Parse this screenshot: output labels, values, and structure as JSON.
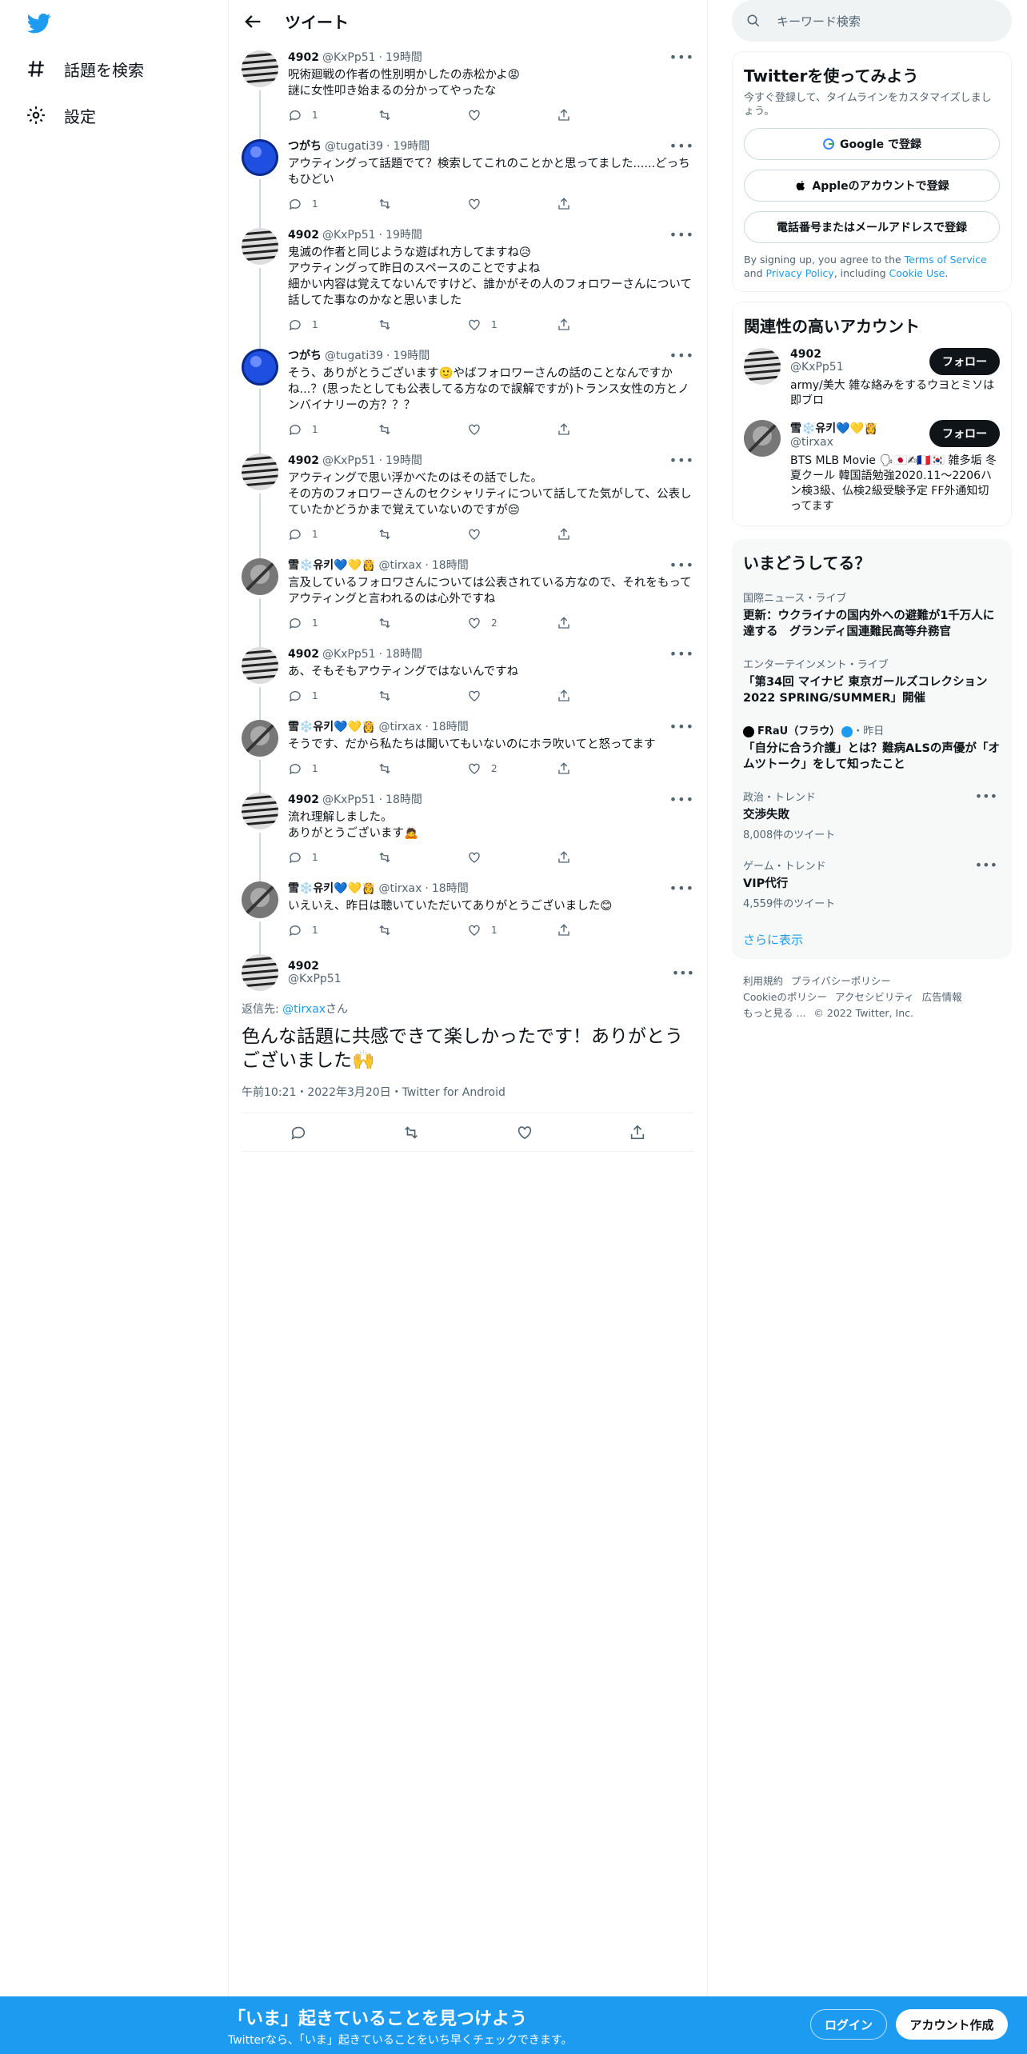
{
  "nav": {
    "explore": "話題を検索",
    "settings": "設定"
  },
  "header": {
    "title": "ツイート"
  },
  "tweets": [
    {
      "name": "4902",
      "handle": "@KxPp51",
      "time": "19時間",
      "text": "呪術廻戦の作者の性別明かしたの赤松かよ😡\n謎に女性叩き始まるの分かってやったな",
      "reply": "1",
      "rt": "",
      "like": "",
      "avatar": "zebra"
    },
    {
      "name": "つがち",
      "handle": "@tugati39",
      "time": "19時間",
      "text": "アウティングって話題でて？検索してこれのことかと思ってました......どっちもひどい",
      "reply": "1",
      "rt": "",
      "like": "",
      "avatar": "blue"
    },
    {
      "name": "4902",
      "handle": "@KxPp51",
      "time": "19時間",
      "text": "鬼滅の作者と同じような遊ばれ方してますね😥\nアウティングって昨日のスペースのことですよね\n細かい内容は覚えてないんですけど、誰かがその人のフォロワーさんについて話してた事なのかなと思いました",
      "reply": "1",
      "rt": "",
      "like": "1",
      "avatar": "zebra"
    },
    {
      "name": "つがち",
      "handle": "@tugati39",
      "time": "19時間",
      "text": "そう、ありがとうございます🙂やばフォロワーさんの話のことなんですかね...？(思ったとしても公表してる方なので誤解ですが)トランス女性の方とノンバイナリーの方？？？",
      "reply": "1",
      "rt": "",
      "like": "",
      "avatar": "blue"
    },
    {
      "name": "4902",
      "handle": "@KxPp51",
      "time": "19時間",
      "text": "アウティングで思い浮かべたのはその話でした。\nその方のフォロワーさんのセクシャリティについて話してた気がして、公表していたかどうかまで覚えていないのですが😔",
      "reply": "1",
      "rt": "",
      "like": "",
      "avatar": "zebra"
    },
    {
      "name": "雪❄️유키💙💛👸",
      "handle": "@tirxax",
      "time": "18時間",
      "text": "言及しているフォロワさんについては公表されている方なので、それをもってアウティングと言われるのは心外ですね",
      "reply": "1",
      "rt": "",
      "like": "2",
      "avatar": "gray"
    },
    {
      "name": "4902",
      "handle": "@KxPp51",
      "time": "18時間",
      "text": "あ、そもそもアウティングではないんですね",
      "reply": "1",
      "rt": "",
      "like": "",
      "avatar": "zebra"
    },
    {
      "name": "雪❄️유키💙💛👸",
      "handle": "@tirxax",
      "time": "18時間",
      "text": "そうです、だから私たちは聞いてもいないのにホラ吹いてと怒ってます",
      "reply": "1",
      "rt": "",
      "like": "2",
      "avatar": "gray"
    },
    {
      "name": "4902",
      "handle": "@KxPp51",
      "time": "18時間",
      "text": "流れ理解しました。\nありがとうございます🙇",
      "reply": "1",
      "rt": "",
      "like": "",
      "avatar": "zebra"
    },
    {
      "name": "雪❄️유키💙💛👸",
      "handle": "@tirxax",
      "time": "18時間",
      "text": "いえいえ、昨日は聴いていただいてありがとうございました😊",
      "reply": "1",
      "rt": "",
      "like": "1",
      "avatar": "gray"
    }
  ],
  "main_tweet": {
    "name": "4902",
    "handle": "@KxPp51",
    "reply_prefix": "返信先: ",
    "reply_to": "@tirxax",
    "reply_suffix": "さん",
    "text": "色んな話題に共感できて楽しかったです！ありがとうございました🙌",
    "meta": "午前10:21・2022年3月20日・Twitter for Android"
  },
  "search": {
    "placeholder": "キーワード検索"
  },
  "signup_card": {
    "title": "Twitterを使ってみよう",
    "subtitle": "今すぐ登録して、タイムラインをカスタマイズしましょう。",
    "google": "Google で登録",
    "apple": "Appleのアカウントで登録",
    "phone": "電話番号またはメールアドレスで登録",
    "fine_1": "By signing up, you agree to the ",
    "terms": "Terms of Service",
    "fine_2": " and ",
    "privacy": "Privacy Policy",
    "fine_3": ", including ",
    "cookie": "Cookie Use",
    "fine_4": "."
  },
  "relevant": {
    "title": "関連性の高いアカウント",
    "follow_label": "フォロー",
    "accounts": [
      {
        "name": "4902",
        "handle": "@KxPp51",
        "bio": "army/美大 雑な絡みをするウヨとミソは即ブロ"
      },
      {
        "name": "雪❄️유키💙💛👸",
        "handle": "@tirxax",
        "bio": "BTS MLB Movie 🗣🇯🇵✍🇫🇷🇰🇷 雑多垢 冬夏クール 韓国語勉強2020.11〜2206ハン検3級、仏検2級受験予定 FF外通知切ってます"
      }
    ]
  },
  "trends": {
    "title": "いまどうしてる？",
    "items": [
      {
        "ctx": "国際ニュース・ライブ",
        "title": "更新：ウクライナの国内外への避難が1千万人に達する　グランディ国連難民高等弁務官",
        "count": ""
      },
      {
        "ctx": "エンターテインメント・ライブ",
        "title": "「第34回 マイナビ 東京ガールズコレクション 2022 SPRING/SUMMER」開催",
        "count": ""
      },
      {
        "ctx": "FRaU（フラウ）",
        "ctx2": "・昨日",
        "title": "「自分に合う介護」とは？難病ALSの声優が「オムツトーク」をして知ったこと",
        "count": ""
      },
      {
        "ctx": "政治・トレンド",
        "title": "交渉失敗",
        "count": "8,008件のツイート"
      },
      {
        "ctx": "ゲーム・トレンド",
        "title": "VIP代行",
        "count": "4,559件のツイート"
      }
    ],
    "show_more": "さらに表示"
  },
  "footer": {
    "links": [
      "利用規約",
      "プライバシーポリシー",
      "Cookieのポリシー",
      "アクセシビリティ",
      "広告情報",
      "もっと見る ..."
    ],
    "copyright": "© 2022 Twitter, Inc."
  },
  "bottom_bar": {
    "headline": "「いま」起きていることを見つけよう",
    "sub": "Twitterなら、「いま」起きていることをいち早くチェックできます。",
    "login": "ログイン",
    "signup": "アカウント作成"
  },
  "colors": {
    "brand": "#1d9bf0",
    "text": "#0f1419",
    "muted": "#536471"
  }
}
